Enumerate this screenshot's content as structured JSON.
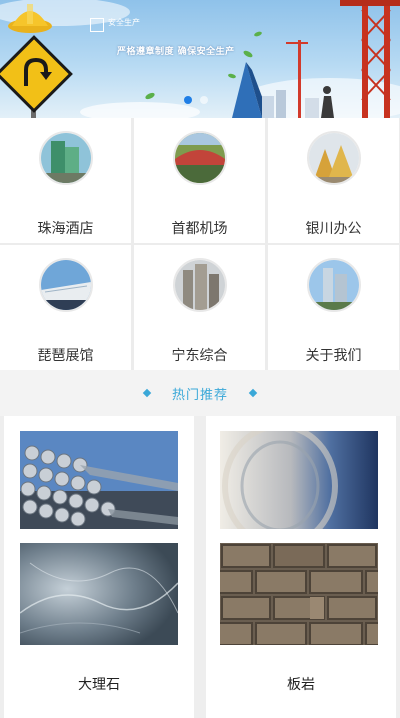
{
  "banner": {
    "logo_text": "安全生产",
    "slogan": "严格遵章制度  确保安全生产",
    "slides": 2,
    "active_slide": 1
  },
  "categories": [
    {
      "label": "珠海酒店",
      "icon": "hotel-building-thumb"
    },
    {
      "label": "首都机场",
      "icon": "airport-thumb"
    },
    {
      "label": "银川办公",
      "icon": "office-thumb"
    },
    {
      "label": "琵琶展馆",
      "icon": "exhibition-hall-thumb"
    },
    {
      "label": "宁东综合",
      "icon": "complex-building-thumb"
    },
    {
      "label": "关于我们",
      "icon": "about-us-thumb"
    }
  ],
  "section": {
    "title": "热门推荐"
  },
  "products": [
    {
      "name": "",
      "image": "steel-pipes-image"
    },
    {
      "name": "",
      "image": "steel-coil-image"
    },
    {
      "name": "大理石",
      "image": "marble-image"
    },
    {
      "name": "板岩",
      "image": "slate-image"
    }
  ],
  "colors": {
    "accent": "#3aa8d8",
    "dot_active": "#1f7ee6"
  }
}
